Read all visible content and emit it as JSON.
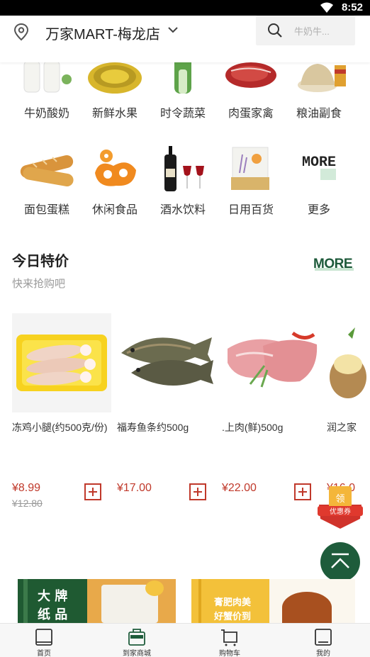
{
  "status_bar": {
    "time": "8:52"
  },
  "header": {
    "store_name": "万家MART-梅龙店",
    "search_placeholder": "牛奶牛..."
  },
  "categories": [
    {
      "label": "牛奶酸奶",
      "icon": "milk-icon"
    },
    {
      "label": "新鲜水果",
      "icon": "durian-icon"
    },
    {
      "label": "时令蔬菜",
      "icon": "vegetable-icon"
    },
    {
      "label": "肉蛋家禽",
      "icon": "meat-icon"
    },
    {
      "label": "粮油副食",
      "icon": "rice-icon"
    },
    {
      "label": "面包蛋糕",
      "icon": "bread-icon"
    },
    {
      "label": "休闲食品",
      "icon": "snack-icon"
    },
    {
      "label": "酒水饮料",
      "icon": "wine-icon"
    },
    {
      "label": "日用百货",
      "icon": "soap-icon"
    },
    {
      "label": "更多",
      "icon": "more-icon"
    }
  ],
  "more_logo_text": "MORE",
  "today": {
    "title": "今日特价",
    "subtitle": "快来抢购吧",
    "more_link": "MORE"
  },
  "products": [
    {
      "name": "冻鸡小腿(约500克/份)",
      "price": "¥8.99",
      "old_price": "¥12.80"
    },
    {
      "name": "福寿鱼条约500g",
      "price": "¥17.00",
      "old_price": ""
    },
    {
      "name": ".上肉(鲜)500g",
      "price": "¥22.00",
      "old_price": ""
    },
    {
      "name": "润之家",
      "price": "¥16.0",
      "old_price": ""
    }
  ],
  "coupon": {
    "top": "领",
    "bottom": "优惠券"
  },
  "banners": [
    {
      "text_line1": "大 牌",
      "text_line2": "纸 品"
    },
    {
      "text_line1": "膏肥肉美",
      "text_line2": "好蟹价到"
    }
  ],
  "tabs": [
    {
      "label": "首页"
    },
    {
      "label": "到家商城"
    },
    {
      "label": "购物车"
    },
    {
      "label": "我的"
    }
  ],
  "colors": {
    "brand_green": "#1e5c3b",
    "price_red": "#c0392b",
    "status_bar": "#000000"
  }
}
